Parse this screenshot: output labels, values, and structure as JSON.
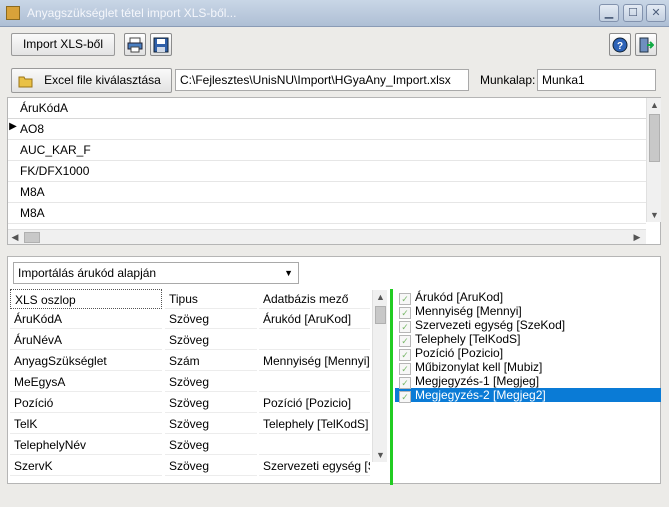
{
  "window": {
    "title": "Anyagszükséglet tétel import XLS-ből..."
  },
  "toolbar": {
    "import_label": "Import XLS-ből"
  },
  "file": {
    "button_label": "Excel file kiválasztása",
    "path": "C:\\Fejlesztes\\UnisNU\\Import\\HGyaAny_Import.xlsx",
    "sheet_label": "Munkalap:",
    "sheet_value": "Munka1"
  },
  "grid1": {
    "header": "ÁruKódA",
    "rows": [
      "AO8",
      "AUC_KAR_F",
      "FK/DFX1000",
      "M8A",
      "M8A"
    ]
  },
  "mode_select": {
    "value": "Importálás árukód alapján"
  },
  "map_table": {
    "headers": [
      "XLS oszlop",
      "Tipus",
      "Adatbázis mező"
    ],
    "rows": [
      [
        "ÁruKódA",
        "Szöveg",
        "Árukód [AruKod]"
      ],
      [
        "ÁruNévA",
        "Szöveg",
        ""
      ],
      [
        "AnyagSzükséglet",
        "Szám",
        "Mennyiség [Mennyi]"
      ],
      [
        "MeEgysA",
        "Szöveg",
        ""
      ],
      [
        "Pozíció",
        "Szöveg",
        "Pozíció [Pozicio]"
      ],
      [
        "TelK",
        "Szöveg",
        "Telephely [TelKodS]"
      ],
      [
        "TelephelyNév",
        "Szöveg",
        ""
      ],
      [
        "SzervK",
        "Szöveg",
        "Szervezeti egység [SzeKod]"
      ]
    ]
  },
  "field_list": {
    "items": [
      "Árukód [AruKod]",
      "Mennyiség [Mennyi]",
      "Szervezeti egység [SzeKod]",
      "Telephely [TelKodS]",
      "Pozíció [Pozicio]",
      "Műbizonylat kell [Mubiz]",
      "Megjegyzés-1 [Megjeg]",
      "Megjegyzés-2 [Megjeg2]"
    ],
    "selected_index": 7
  },
  "colors": {
    "accent_green": "#22cc22",
    "selection_blue": "#0a7bd6"
  }
}
